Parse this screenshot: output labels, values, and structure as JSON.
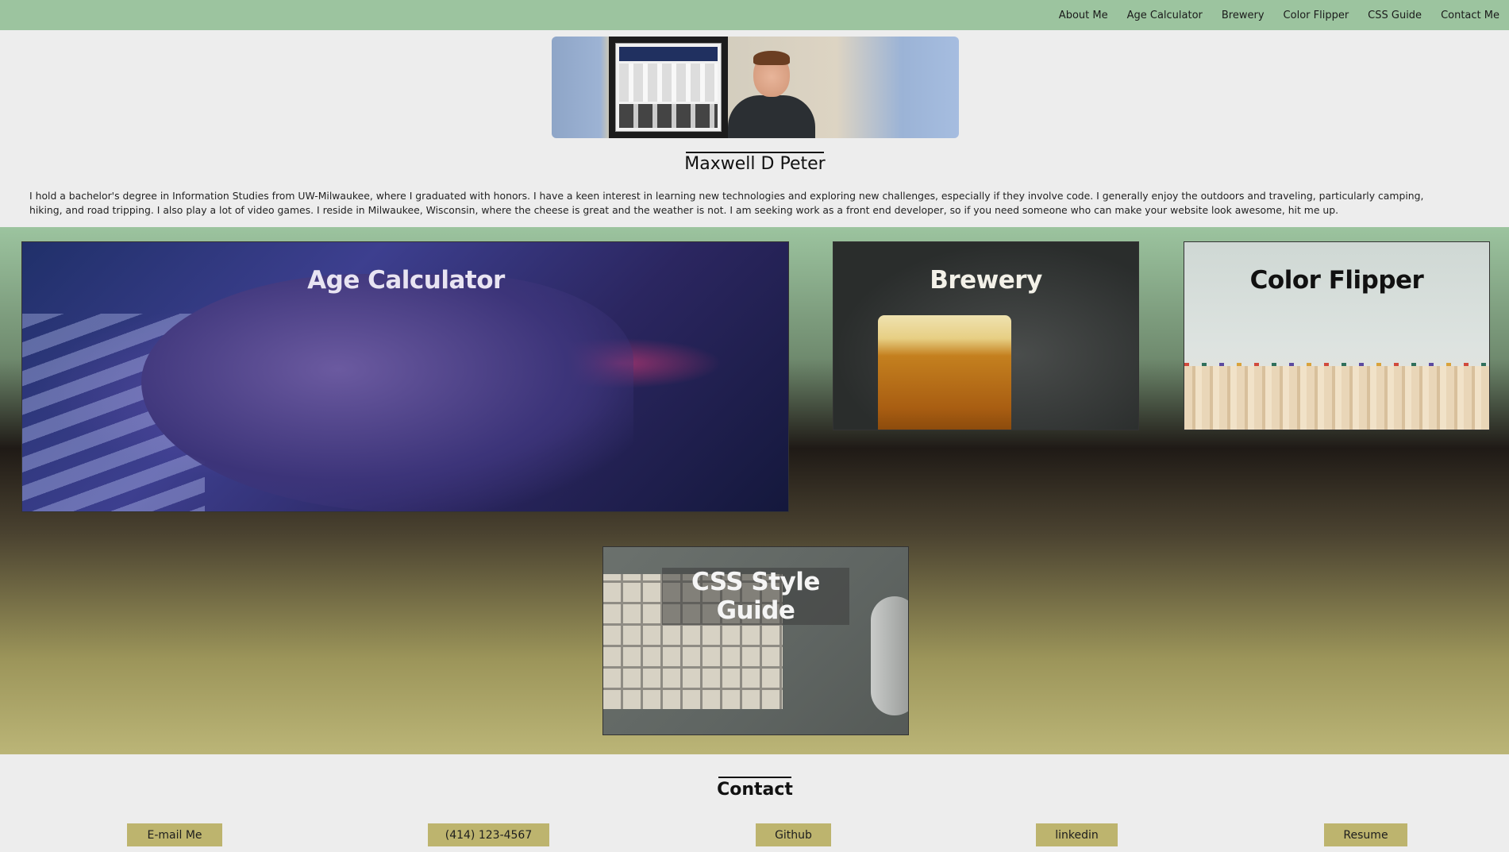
{
  "nav": {
    "items": [
      "About Me",
      "Age Calculator",
      "Brewery",
      "Color Flipper",
      "CSS Guide",
      "Contact Me"
    ]
  },
  "profile": {
    "name": "Maxwell D Peter",
    "bio": "I hold a bachelor's degree in Information Studies from UW-Milwaukee, where I graduated with honors. I have a keen interest in learning new technologies and exploring new challenges, especially if they involve code. I generally enjoy the outdoors and traveling, particularly camping, hiking, and road tripping. I also play a lot of video games. I reside in Milwaukee, Wisconsin, where the cheese is great and the weather is not. I am seeking work as a front end developer, so if you need someone who can make your website look awesome, hit me up."
  },
  "projects": {
    "age": {
      "title": "Age Calculator"
    },
    "brewery": {
      "title": "Brewery"
    },
    "color": {
      "title": "Color Flipper"
    },
    "css": {
      "title": "CSS Style Guide"
    }
  },
  "contact": {
    "title": "Contact",
    "buttons": {
      "email": "E-mail Me",
      "phone": "(414) 123-4567",
      "github": "Github",
      "linkedin": "linkedin",
      "resume": "Resume"
    }
  },
  "colors": {
    "nav_bg": "#9cc49f",
    "button_bg": "#bdb46e",
    "page_bg": "#ededed"
  }
}
